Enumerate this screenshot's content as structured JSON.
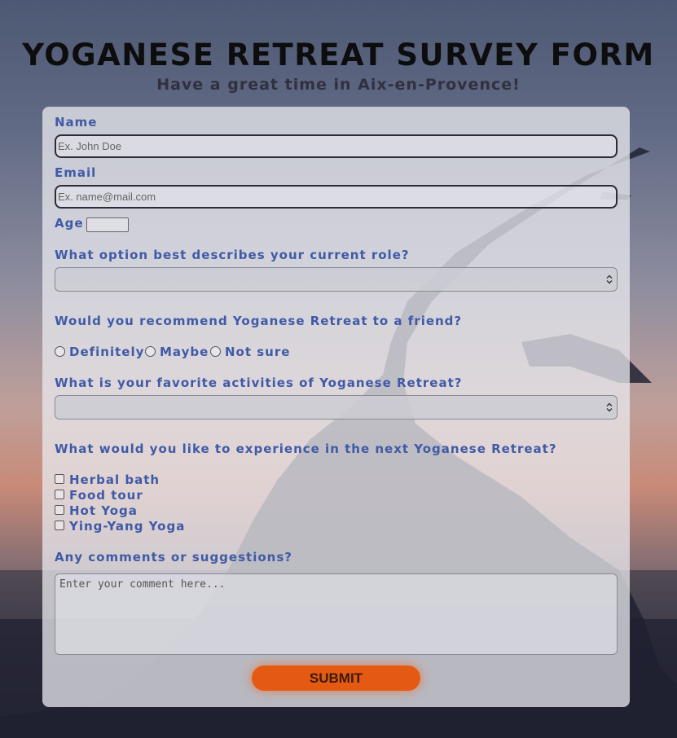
{
  "header": {
    "title": "YOGANESE RETREAT SURVEY FORM",
    "subtitle": "Have a great time in Aix-en-Provence!"
  },
  "form": {
    "name": {
      "label": "Name",
      "placeholder": "Ex. John Doe",
      "value": ""
    },
    "email": {
      "label": "Email",
      "placeholder": "Ex. name@mail.com",
      "value": ""
    },
    "age": {
      "label": "Age",
      "value": ""
    },
    "role": {
      "question": "What option best describes your current role?",
      "selected": ""
    },
    "recommend": {
      "question": "Would you recommend Yoganese Retreat to a friend?",
      "options": [
        "Definitely",
        "Maybe",
        "Not sure"
      ]
    },
    "favorite": {
      "question": "What is your favorite activities of Yoganese Retreat?",
      "selected": ""
    },
    "experience": {
      "question": "What would you like to experience in the next Yoganese Retreat?",
      "options": [
        "Herbal bath",
        "Food tour",
        "Hot Yoga",
        "Ying-Yang Yoga"
      ]
    },
    "comments": {
      "question": "Any comments or suggestions?",
      "placeholder": "Enter your comment here..."
    },
    "submit_label": "SUBMIT"
  },
  "colors": {
    "label": "#3f5aa6",
    "accent": "#e45a12",
    "title": "#0d0d0d"
  },
  "icons": {
    "select_arrow": "chevron-up-down-icon"
  }
}
